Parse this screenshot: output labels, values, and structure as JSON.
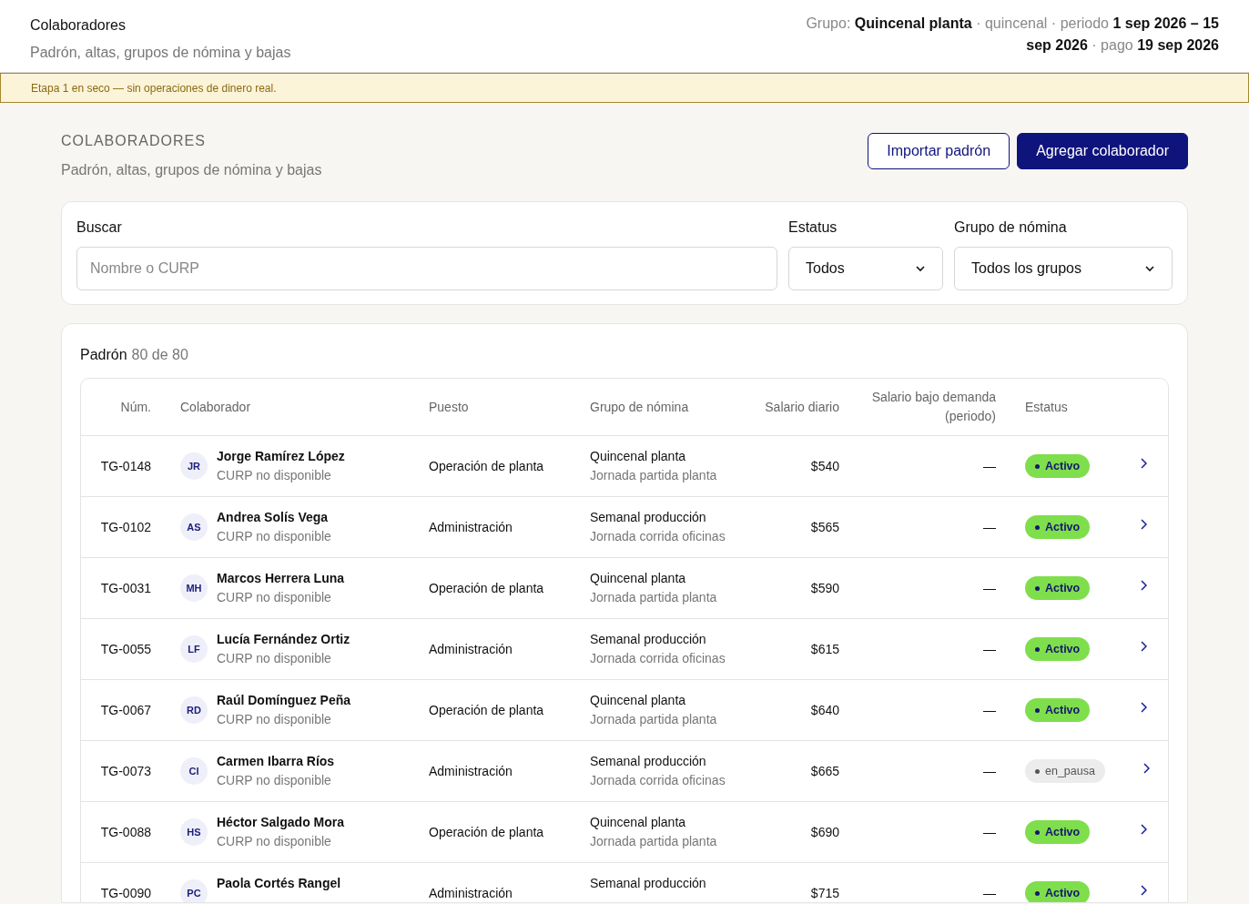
{
  "header": {
    "title": "Colaboradores",
    "subtitle": "Padrón, altas, grupos de nómina y bajas",
    "period_info": "Grupo: **Quincenal planta** · quincenal · periodo **1 sep 2026 – 15 sep 2026** · pago **19 sep 2026**"
  },
  "banner": "Etapa 1 en seco — sin operaciones de dinero real.",
  "page": {
    "eyebrow": "COLABORADORES",
    "subtitle": "Padrón, altas, grupos de nómina y bajas",
    "buttons": [
      {
        "label": "Importar padrón",
        "kind": "secondary"
      },
      {
        "label": "Agregar colaborador",
        "kind": "primary"
      }
    ]
  },
  "filters": {
    "search": {
      "label": "Buscar",
      "placeholder": "Nombre o CURP"
    },
    "status": {
      "label": "Estatus",
      "value": "Todos"
    },
    "group": {
      "label": "Grupo de nómina",
      "value": "Todos los grupos"
    }
  },
  "table": {
    "title": "Padrón",
    "count": "80 de 80",
    "columns": [
      "Núm.",
      "Colaborador",
      "Puesto",
      "Grupo de nómina",
      "Salario diario",
      "Salario bajo demanda (periodo)",
      "Estatus"
    ],
    "rows": [
      {
        "num": "TG-0148",
        "initials": "JR",
        "name": "Jorge Ramírez López",
        "curp": "CURP no disponible",
        "position": "Operación de planta",
        "group": "Quincenal planta",
        "shift": "Jornada partida planta",
        "salary": "$540",
        "on_demand": "—",
        "status": "Activo",
        "kind": "active"
      },
      {
        "num": "TG-0102",
        "initials": "AS",
        "name": "Andrea Solís Vega",
        "curp": "CURP no disponible",
        "position": "Administración",
        "group": "Semanal producción",
        "shift": "Jornada corrida oficinas",
        "salary": "$565",
        "on_demand": "—",
        "status": "Activo",
        "kind": "active"
      },
      {
        "num": "TG-0031",
        "initials": "MH",
        "name": "Marcos Herrera Luna",
        "curp": "CURP no disponible",
        "position": "Operación de planta",
        "group": "Quincenal planta",
        "shift": "Jornada partida planta",
        "salary": "$590",
        "on_demand": "—",
        "status": "Activo",
        "kind": "active"
      },
      {
        "num": "TG-0055",
        "initials": "LF",
        "name": "Lucía Fernández Ortiz",
        "curp": "CURP no disponible",
        "position": "Administración",
        "group": "Semanal producción",
        "shift": "Jornada corrida oficinas",
        "salary": "$615",
        "on_demand": "—",
        "status": "Activo",
        "kind": "active"
      },
      {
        "num": "TG-0067",
        "initials": "RD",
        "name": "Raúl Domínguez Peña",
        "curp": "CURP no disponible",
        "position": "Operación de planta",
        "group": "Quincenal planta",
        "shift": "Jornada partida planta",
        "salary": "$640",
        "on_demand": "—",
        "status": "Activo",
        "kind": "active"
      },
      {
        "num": "TG-0073",
        "initials": "CI",
        "name": "Carmen Ibarra Ríos",
        "curp": "CURP no disponible",
        "position": "Administración",
        "group": "Semanal producción",
        "shift": "Jornada corrida oficinas",
        "salary": "$665",
        "on_demand": "—",
        "status": "en_pausa",
        "kind": "paused"
      },
      {
        "num": "TG-0088",
        "initials": "HS",
        "name": "Héctor Salgado Mora",
        "curp": "CURP no disponible",
        "position": "Operación de planta",
        "group": "Quincenal planta",
        "shift": "Jornada partida planta",
        "salary": "$690",
        "on_demand": "—",
        "status": "Activo",
        "kind": "active"
      },
      {
        "num": "TG-0090",
        "initials": "PC",
        "name": "Paola Cortés Rangel",
        "position": "Administración",
        "group": "Semanal producción",
        "salary": "$715",
        "on_demand": "—",
        "status": "Activo",
        "kind": "active"
      }
    ]
  }
}
